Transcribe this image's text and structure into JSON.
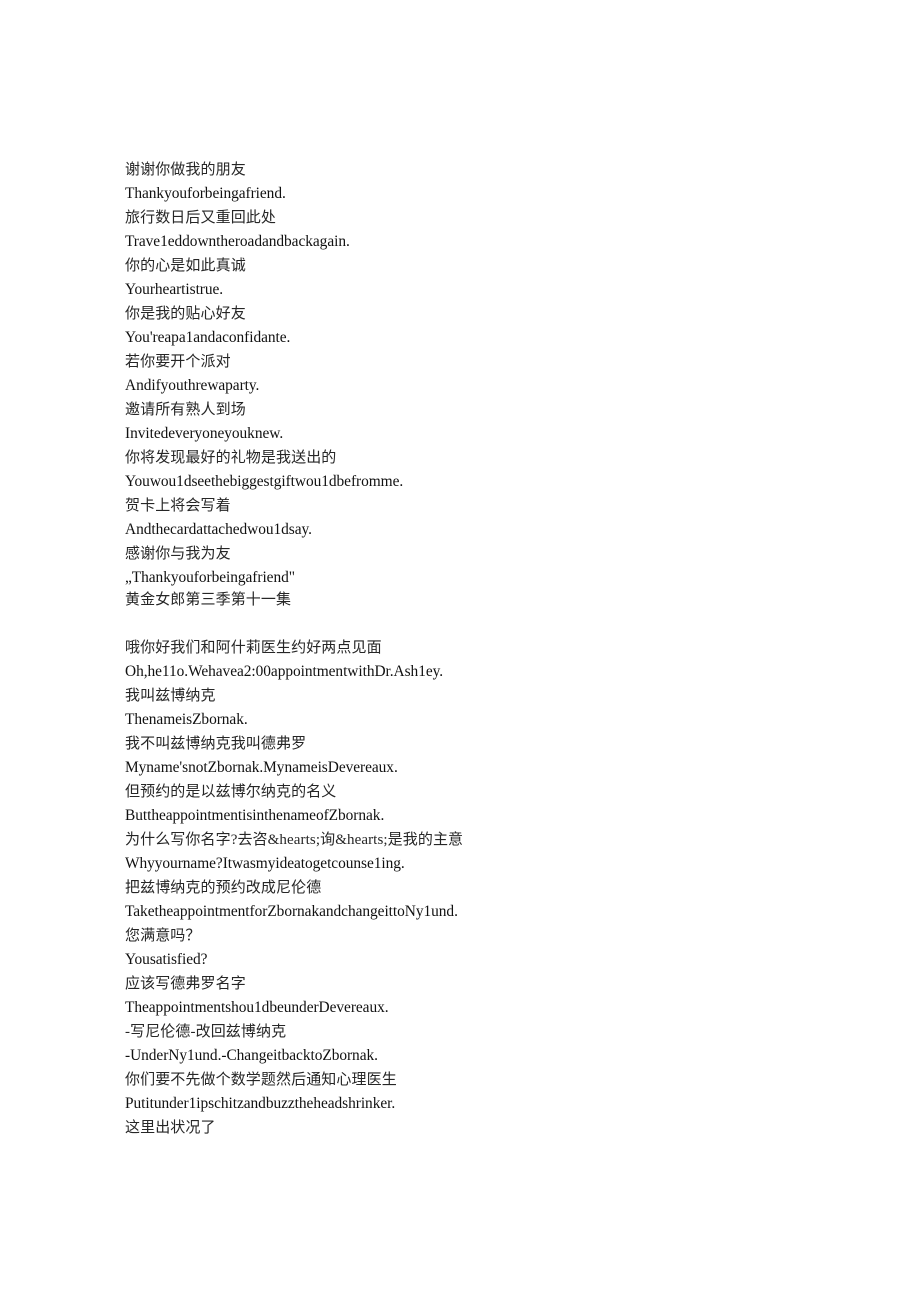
{
  "document": {
    "background_color": "#ffffff",
    "text_color": "#1a1a1a",
    "blocks": [
      {
        "id": "block-1",
        "lines": [
          {
            "lang": "zh",
            "text": "谢谢你做我的朋友"
          },
          {
            "lang": "en",
            "text": "Thankyouforbeingafriend."
          },
          {
            "lang": "zh",
            "text": "旅行数日后又重回此处"
          },
          {
            "lang": "en",
            "text": "Trave1eddowntheroadandbackagain."
          },
          {
            "lang": "zh",
            "text": "你的心是如此真诚"
          },
          {
            "lang": "en",
            "text": "Yourheartistrue."
          },
          {
            "lang": "zh",
            "text": "你是我的贴心好友"
          },
          {
            "lang": "en",
            "text": "You'reapa1andaconfidante."
          },
          {
            "lang": "zh",
            "text": "若你要开个派对"
          },
          {
            "lang": "en",
            "text": "Andifyouthrewaparty."
          },
          {
            "lang": "zh",
            "text": "邀请所有熟人到场"
          },
          {
            "lang": "en",
            "text": "Invitedeveryoneyouknew."
          },
          {
            "lang": "zh",
            "text": "你将发现最好的礼物是我送出的"
          },
          {
            "lang": "en",
            "text": "Youwou1dseethebiggestgiftwou1dbefromme."
          },
          {
            "lang": "zh",
            "text": "贺卡上将会写着"
          },
          {
            "lang": "en",
            "text": "Andthecardattachedwou1dsay."
          },
          {
            "lang": "zh",
            "text": "感谢你与我为友"
          },
          {
            "lang": "en",
            "text": "„Thankyouforbeingafriend\"",
            "tight": true
          },
          {
            "lang": "zh",
            "text": "黄金女郎第三季第十一集",
            "tight": true
          }
        ]
      },
      {
        "id": "block-2",
        "lines": [
          {
            "lang": "zh",
            "text": "哦你好我们和阿什莉医生约好两点见面"
          },
          {
            "lang": "en",
            "text": "Oh,he11o.Wehavea2:00appointmentwithDr.Ash1ey."
          },
          {
            "lang": "zh",
            "text": "我叫兹博纳克"
          },
          {
            "lang": "en",
            "text": "ThenameisZbornak."
          },
          {
            "lang": "zh",
            "text": "我不叫兹博纳克我叫德弗罗"
          },
          {
            "lang": "en",
            "text": "Myname'snotZbornak.MynameisDevereaux."
          },
          {
            "lang": "zh",
            "text": "但预约的是以兹博尔纳克的名义"
          },
          {
            "lang": "en",
            "text": "ButtheappointmentisinthenameofZbornak."
          },
          {
            "lang": "zh",
            "text": "为什么写你名字?去咨&hearts;询&hearts;是我的主意"
          },
          {
            "lang": "en",
            "text": "Whyyourname?Itwasmyideatogetcounse1ing."
          },
          {
            "lang": "zh",
            "text": "把兹博纳克的预约改成尼伦德"
          },
          {
            "lang": "en",
            "text": "TaketheappointmentforZbornakandchangeittoNy1und."
          },
          {
            "lang": "zh",
            "text": "您满意吗？"
          },
          {
            "lang": "en",
            "text": "Yousatisfied?"
          },
          {
            "lang": "zh",
            "text": "应该写德弗罗名字"
          },
          {
            "lang": "en",
            "text": "Theappointmentshou1dbeunderDevereaux."
          },
          {
            "lang": "zh",
            "text": "-写尼伦德-改回兹博纳克"
          },
          {
            "lang": "en",
            "text": "-UnderNy1und.-ChangeitbacktoZbornak."
          },
          {
            "lang": "zh",
            "text": "你们要不先做个数学题然后通知心理医生"
          },
          {
            "lang": "en",
            "text": "Putitunder1ipschitzandbuzztheheadshrinker."
          },
          {
            "lang": "zh",
            "text": "这里出状况了"
          }
        ]
      }
    ]
  }
}
